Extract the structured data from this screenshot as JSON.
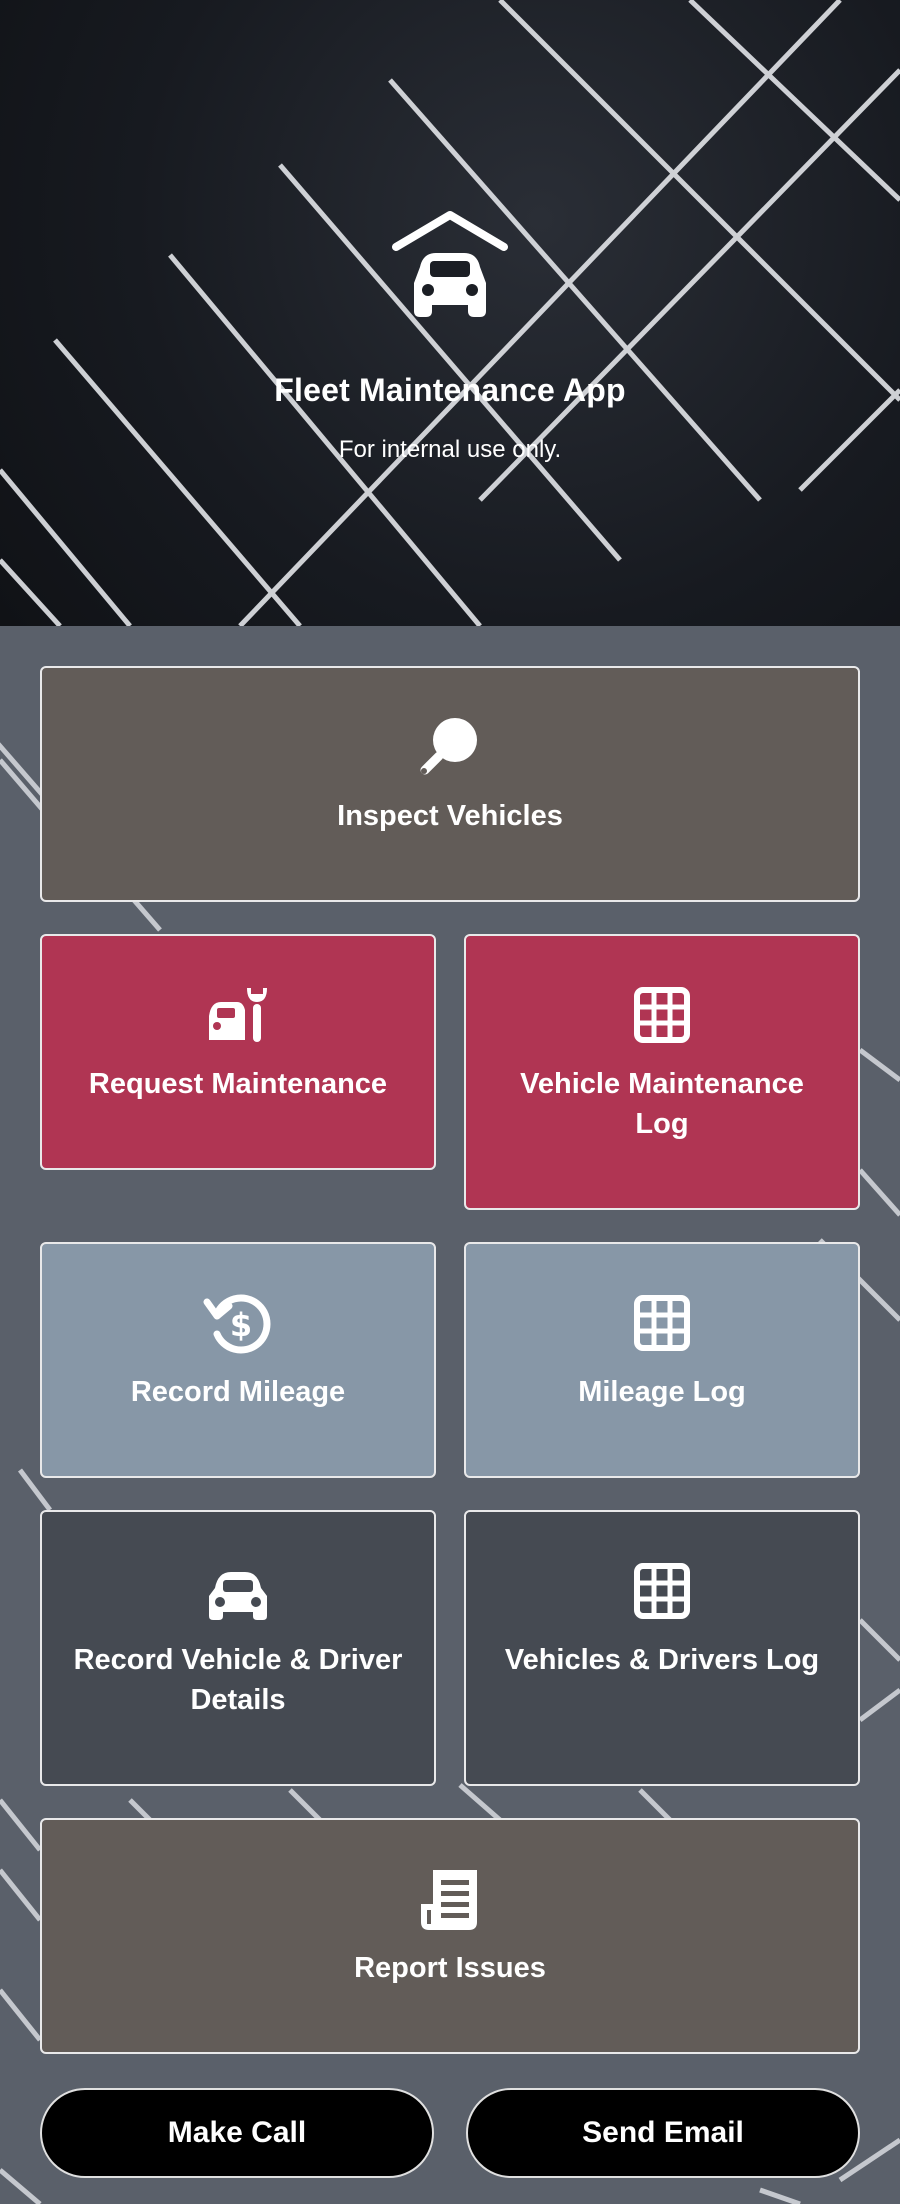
{
  "header": {
    "title": "Fleet Maintenance App",
    "subtitle": "For internal use only.",
    "icon": "garage-car-icon"
  },
  "tiles": [
    {
      "label": "Inspect Vehicles",
      "icon": "magnifier-icon",
      "color": "#625c58"
    },
    {
      "label": "Request Maintenance",
      "icon": "car-wrench-icon",
      "color": "#b03553"
    },
    {
      "label": "Vehicle Maintenance Log",
      "icon": "grid-icon",
      "color": "#b03553"
    },
    {
      "label": "Record Mileage",
      "icon": "dollar-history-icon",
      "color": "#8797a7"
    },
    {
      "label": "Mileage Log",
      "icon": "grid-icon",
      "color": "#8797a7"
    },
    {
      "label": "Record Vehicle & Driver Details",
      "icon": "car-icon",
      "color": "#454a52"
    },
    {
      "label": "Vehicles & Drivers Log",
      "icon": "grid-icon",
      "color": "#454a52"
    },
    {
      "label": "Report Issues",
      "icon": "newspaper-icon",
      "color": "#625c58"
    }
  ],
  "buttons": {
    "call": "Make Call",
    "email": "Send Email"
  }
}
